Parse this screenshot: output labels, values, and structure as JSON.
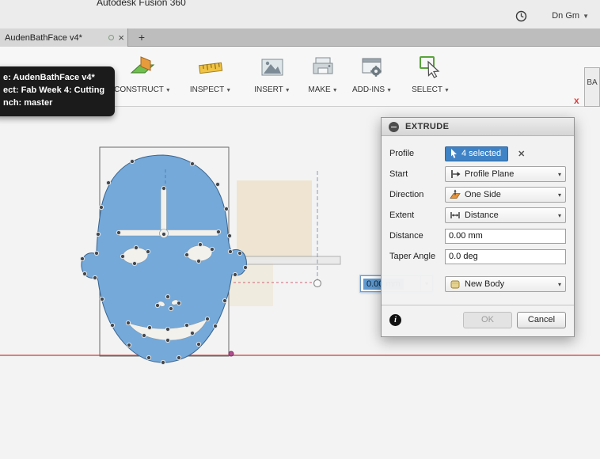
{
  "titlebar": {
    "app_title": "Autodesk Fusion 360",
    "user_menu": "Dn Gm"
  },
  "tabbar": {
    "tab_label": "AudenBathFace v4*",
    "new_tab_label": "+"
  },
  "toolbar": {
    "items": [
      {
        "label": "CONSTRUCT"
      },
      {
        "label": "INSPECT"
      },
      {
        "label": "INSERT"
      },
      {
        "label": "MAKE"
      },
      {
        "label": "ADD-INS"
      },
      {
        "label": "SELECT"
      }
    ]
  },
  "tooltip": {
    "line1": "e: AudenBathFace v4*",
    "line2": "ect: Fab Week 4: Cutting",
    "line3": "nch: master"
  },
  "canvas": {
    "dimension_value": "0.00 mm"
  },
  "dialog": {
    "title": "EXTRUDE",
    "profile": {
      "label": "Profile",
      "value": "4 selected"
    },
    "start": {
      "label": "Start",
      "value": "Profile Plane"
    },
    "direction": {
      "label": "Direction",
      "value": "One Side"
    },
    "extent": {
      "label": "Extent",
      "value": "Distance"
    },
    "distance": {
      "label": "Distance",
      "value": "0.00 mm"
    },
    "taper": {
      "label": "Taper Angle",
      "value": "0.0 deg"
    },
    "operation": {
      "value": "New Body"
    },
    "ok_label": "OK",
    "cancel_label": "Cancel"
  },
  "side_panel": {
    "label": "BA",
    "axis_label": "x"
  },
  "icons": {
    "close": "×",
    "caret_down": "▾",
    "chip_clear": "✕",
    "info": "i"
  },
  "colors": {
    "face_fill": "#74a9da",
    "selection_chip": "#3f83c6",
    "axis_red": "#cf3a3a",
    "text_highlight": "#5f9ad0"
  }
}
